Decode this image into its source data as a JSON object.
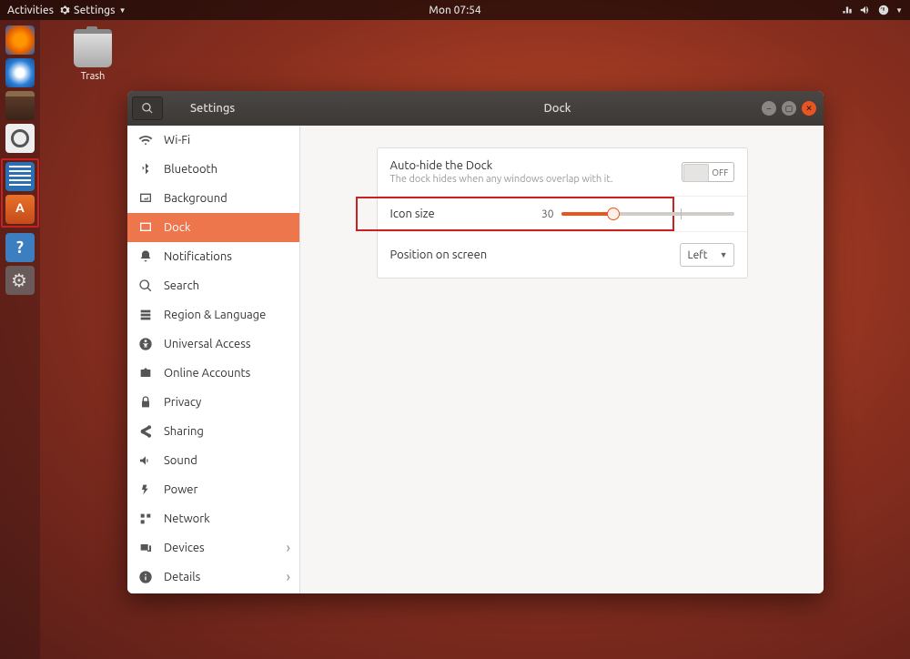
{
  "topbar": {
    "activities": "Activities",
    "app_menu": "Settings",
    "clock": "Mon 07:54"
  },
  "desktop": {
    "trash_label": "Trash"
  },
  "window": {
    "title": "Settings",
    "pane_title": "Dock"
  },
  "sidebar": {
    "items": [
      {
        "icon": "wifi",
        "label": "Wi-Fi"
      },
      {
        "icon": "bluetooth",
        "label": "Bluetooth"
      },
      {
        "icon": "background",
        "label": "Background"
      },
      {
        "icon": "dock",
        "label": "Dock",
        "active": true
      },
      {
        "icon": "bell",
        "label": "Notifications"
      },
      {
        "icon": "search",
        "label": "Search"
      },
      {
        "icon": "region",
        "label": "Region & Language"
      },
      {
        "icon": "universal",
        "label": "Universal Access"
      },
      {
        "icon": "online",
        "label": "Online Accounts"
      },
      {
        "icon": "privacy",
        "label": "Privacy"
      },
      {
        "icon": "sharing",
        "label": "Sharing"
      },
      {
        "icon": "sound",
        "label": "Sound"
      },
      {
        "icon": "power",
        "label": "Power"
      },
      {
        "icon": "network",
        "label": "Network"
      },
      {
        "icon": "devices",
        "label": "Devices",
        "chevron": true
      },
      {
        "icon": "details",
        "label": "Details",
        "chevron": true
      }
    ]
  },
  "dock_settings": {
    "autohide": {
      "title": "Auto-hide the Dock",
      "subtitle": "The dock hides when any windows overlap with it.",
      "state_label": "OFF",
      "state": false
    },
    "icon_size": {
      "label": "Icon size",
      "value": "30",
      "min": 16,
      "max": 64
    },
    "position": {
      "label": "Position on screen",
      "value": "Left"
    }
  }
}
